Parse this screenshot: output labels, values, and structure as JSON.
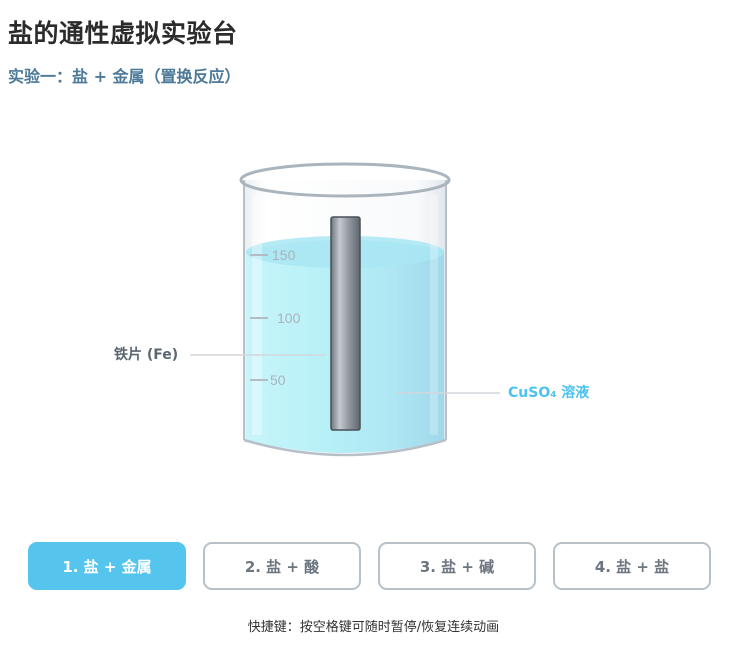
{
  "page": {
    "title": "盐的通性虚拟实验台",
    "subtitle": "实验一：盐 + 金属（置换反应）"
  },
  "beaker": {
    "scale_marks": [
      "150",
      "100",
      "50"
    ],
    "labels": {
      "metal": "铁片 (Fe)",
      "solution": "CuSO₄ 溶液"
    }
  },
  "tabs": [
    {
      "label": "1. 盐 + 金属",
      "active": true
    },
    {
      "label": "2. 盐 + 酸",
      "active": false
    },
    {
      "label": "3. 盐 + 碱",
      "active": false
    },
    {
      "label": "4. 盐 + 盐",
      "active": false
    }
  ],
  "hint": "快捷键：按空格键可随时暂停/恢复连续动画",
  "colors": {
    "accent": "#55c5ee",
    "solution_label": "#4cc3ec",
    "subtitle": "#4d7a99"
  }
}
